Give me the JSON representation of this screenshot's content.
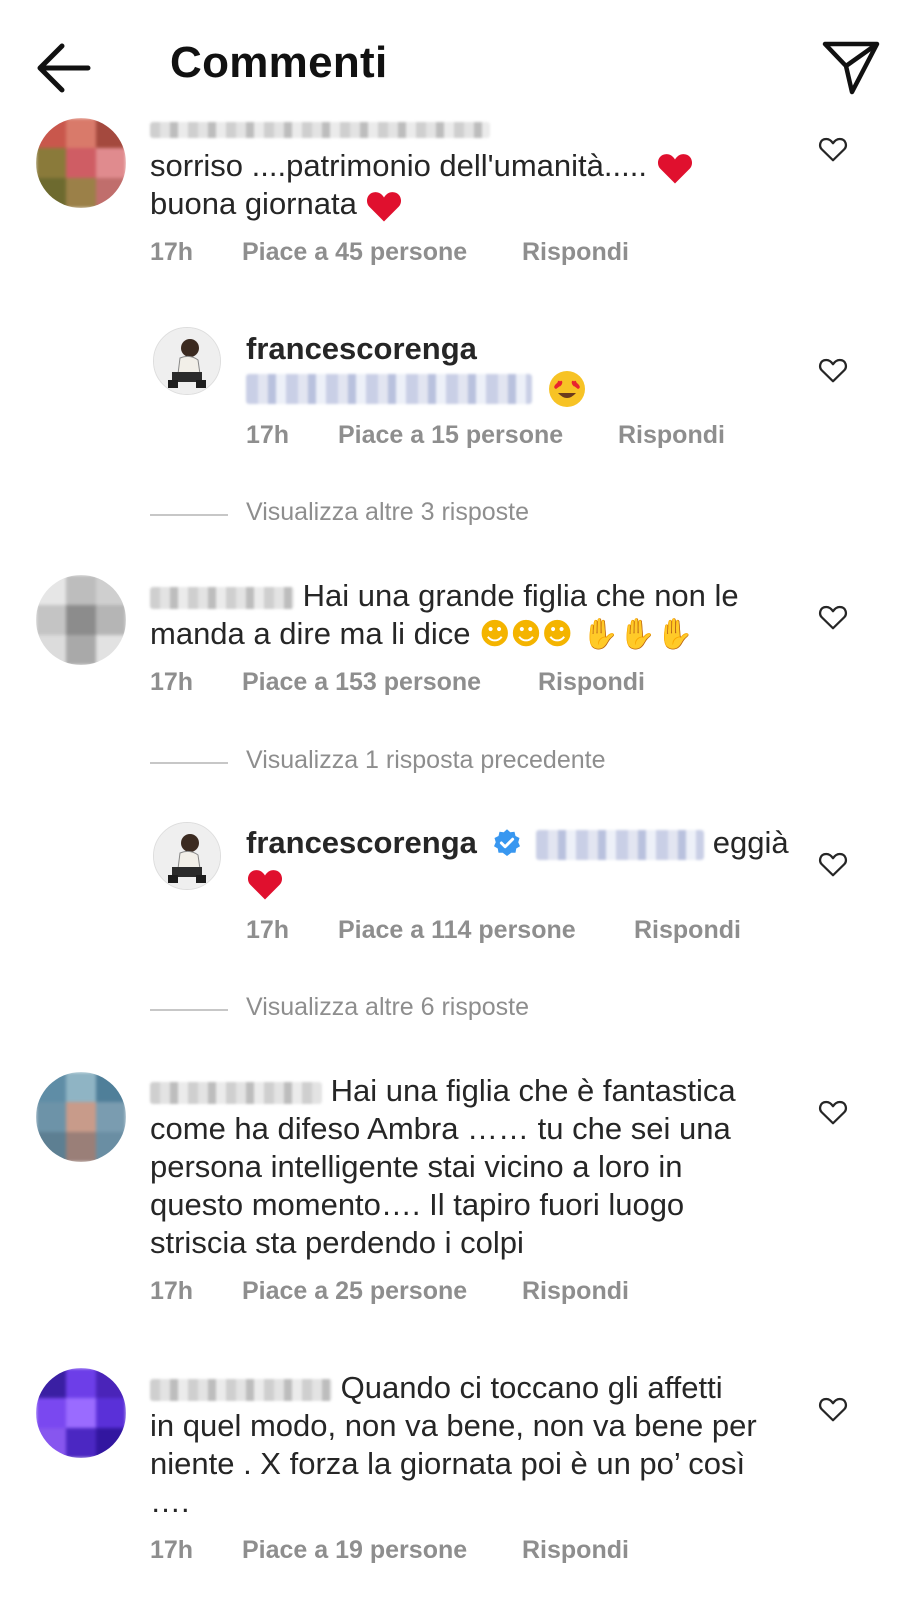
{
  "header": {
    "title": "Commenti",
    "back_icon": "arrow-left-icon",
    "send_icon": "paper-plane-icon"
  },
  "comments": [
    {
      "line1": "sorriso ....patrimonio dell'umanità.....",
      "line2": "buona giornata",
      "time": "17h",
      "likes": "Piace a 45 persone",
      "reply": "Rispondi"
    },
    {
      "username": "francescorenga",
      "time": "17h",
      "likes": "Piace a 15 persone",
      "reply": "Rispondi"
    },
    {
      "line1": "Hai una grande figlia che non le",
      "line2": "manda a dire ma li dice",
      "time": "17h",
      "likes": "Piace a 153 persone",
      "reply": "Rispondi"
    },
    {
      "username": "francescorenga",
      "text_after": "eggià",
      "time": "17h",
      "likes": "Piace a 114 persone",
      "reply": "Rispondi"
    },
    {
      "line1": "Hai una figlia che è fantastica",
      "line2": "come ha difeso Ambra …… tu che sei una",
      "line3": "persona intelligente stai vicino a loro in",
      "line4": "questo momento…. Il tapiro fuori luogo",
      "line5": "striscia sta perdendo i colpi",
      "time": "17h",
      "likes": "Piace a 25 persone",
      "reply": "Rispondi"
    },
    {
      "line1": "Quando ci toccano gli affetti",
      "line2": "in quel modo, non va bene, non va bene per",
      "line3": "niente .  X forza la giornata poi è un po’ così",
      "line4": "….",
      "time": "17h",
      "likes": "Piace a 19 persone",
      "reply": "Rispondi"
    }
  ],
  "view_more": [
    "Visualizza altre 3 risposte",
    "Visualizza 1 risposta precedente",
    "Visualizza altre 6 risposte"
  ],
  "colors": {
    "text": "#262626",
    "secondary": "#8e8e8e",
    "verified": "#3897f0",
    "heart_emoji": "#e0102e"
  }
}
